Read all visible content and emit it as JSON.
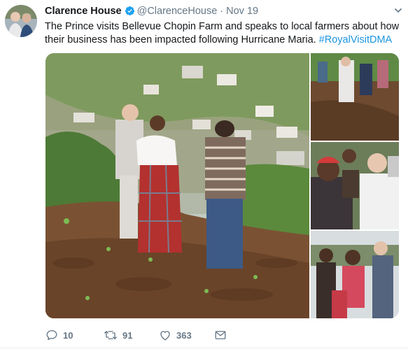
{
  "tweet": {
    "display_name": "Clarence House",
    "handle": "@ClarenceHouse",
    "separator": "·",
    "timestamp": "Nov 19",
    "text_main": "The Prince visits Bellevue Chopin Farm and speaks to local farmers about how their business has been impacted following Hurricane Maria. ",
    "hashtag": "#RoyalVisitDMA",
    "verified_icon": "verified-badge-icon",
    "menu_icon": "chevron-down-icon"
  },
  "actions": {
    "replies": "10",
    "retweets": "91",
    "likes": "363",
    "reply_icon": "reply-icon",
    "retweet_icon": "retweet-icon",
    "like_icon": "heart-icon",
    "dm_icon": "envelope-icon"
  },
  "colors": {
    "link": "#1b95e0",
    "secondary_text": "#657786",
    "primary_text": "#14171a",
    "divider": "#e6ecf0"
  }
}
